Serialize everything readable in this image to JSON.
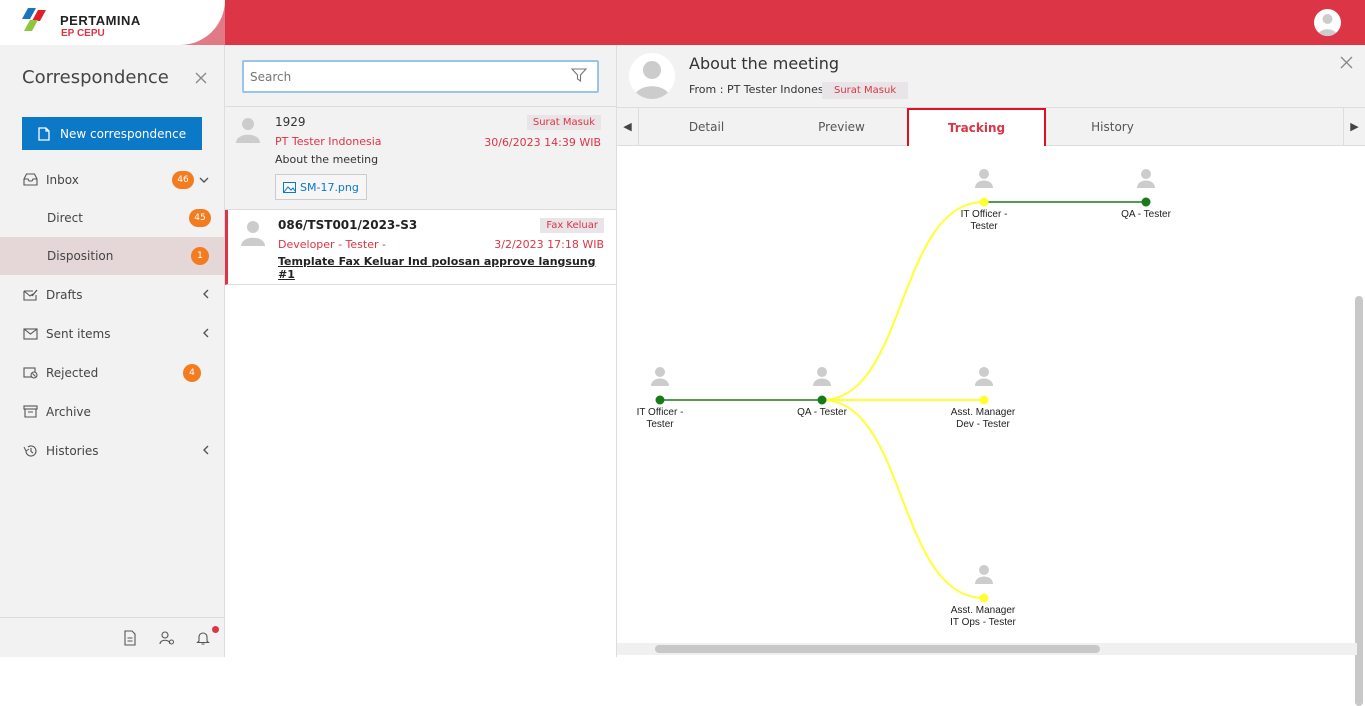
{
  "brand": {
    "name": "PERTAMINA",
    "sub": "EP CEPU"
  },
  "colors": {
    "accent": "#dc3545",
    "primary": "#0b78c8",
    "badge": "#f47c20",
    "line_done": "#1a7a1a",
    "line_pending": "#ffff33"
  },
  "sidebar": {
    "title": "Correspondence",
    "new_button": "New correspondence",
    "items": [
      {
        "label": "Inbox",
        "icon": "inbox-icon",
        "badge": "46",
        "chevron": "chevron-down-icon"
      },
      {
        "label": "Direct",
        "badge": "45"
      },
      {
        "label": "Disposition",
        "badge": "1"
      },
      {
        "label": "Drafts",
        "icon": "drafts-icon",
        "chevron": "chevron-left-icon"
      },
      {
        "label": "Sent items",
        "icon": "sent-icon",
        "chevron": "chevron-left-icon"
      },
      {
        "label": "Rejected",
        "icon": "rejected-icon",
        "badge": "4"
      },
      {
        "label": "Archive",
        "icon": "archive-icon"
      },
      {
        "label": "Histories",
        "icon": "history-icon",
        "chevron": "chevron-left-icon"
      }
    ]
  },
  "search": {
    "placeholder": "Search"
  },
  "list": [
    {
      "number": "1929",
      "from": "PT Tester Indonesia",
      "tag": "Surat Masuk",
      "date": "30/6/2023 14:39 WIB",
      "subject": "About the meeting",
      "attachment": "SM-17.png"
    },
    {
      "number": "086/TST001/2023-S3",
      "from": "Developer - Tester -",
      "tag": "Fax Keluar",
      "date": "3/2/2023 17:18 WIB",
      "subject": "Template Fax Keluar Ind polosan approve langsung #1"
    }
  ],
  "detail": {
    "title": "About the meeting",
    "from": "From : PT Tester Indonesia",
    "tag": "Surat Masuk",
    "tabs": [
      "Detail",
      "Preview",
      "Tracking",
      "History"
    ],
    "active_tab": "Tracking"
  },
  "tracking": {
    "nodes": [
      {
        "id": "n1",
        "line1": "IT Officer -",
        "line2": "Tester",
        "status": "done"
      },
      {
        "id": "n2",
        "line1": "QA - Tester",
        "line2": "",
        "status": "done"
      },
      {
        "id": "n3",
        "line1": "IT Officer -",
        "line2": "Tester",
        "status": "pending"
      },
      {
        "id": "n4",
        "line1": "QA - Tester",
        "line2": "",
        "status": "done"
      },
      {
        "id": "n5",
        "line1": "Asst. Manager",
        "line2": "Dev - Tester",
        "status": "pending"
      },
      {
        "id": "n6",
        "line1": "Asst. Manager",
        "line2": "IT Ops - Tester",
        "status": "pending"
      }
    ]
  }
}
